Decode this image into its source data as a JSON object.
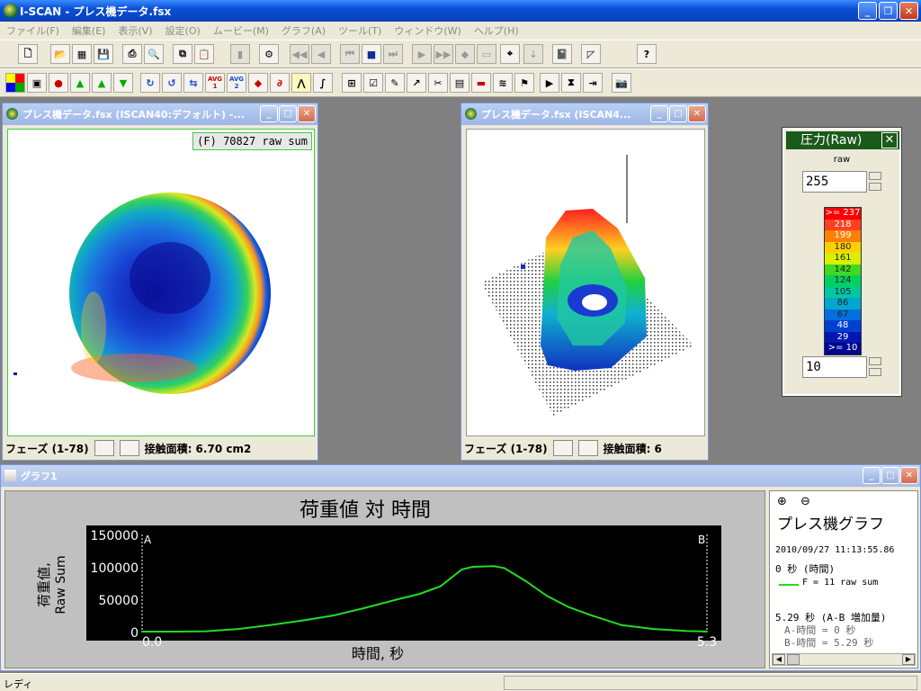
{
  "app": {
    "title": "I-SCAN - プレス機データ.fsx"
  },
  "menu": [
    "ファイル(F)",
    "編集(E)",
    "表示(V)",
    "設定(O)",
    "ムービー(M)",
    "グラフ(A)",
    "ツール(T)",
    "ウィンドウ(W)",
    "ヘルプ(H)"
  ],
  "toolbar2_labels": {
    "avg1": "AVG 1",
    "avg2": "AVG 2"
  },
  "win2d": {
    "title": "プレス機データ.fsx (ISCAN40:デフォルト) -...",
    "overlay": "(F) 70827 raw sum",
    "frame": "フェーズ (1-78)",
    "contact": "接触面積: 6.70 cm2"
  },
  "win3d": {
    "title": "プレス機データ.fsx (ISCAN4...",
    "frame": "フェーズ (1-78)",
    "contact": "接触面積: 6"
  },
  "legend": {
    "title": "圧力(Raw)",
    "unit": "raw",
    "max_value": "255",
    "min_value": "10",
    "scale": [
      {
        "label": ">= 237",
        "color": "#ff0000"
      },
      {
        "label": "218",
        "color": "#ff4020"
      },
      {
        "label": "199",
        "color": "#ff8000"
      },
      {
        "label": "180",
        "color": "#ffd000"
      },
      {
        "label": "161",
        "color": "#d8f000"
      },
      {
        "label": "142",
        "color": "#40d820"
      },
      {
        "label": "124",
        "color": "#00d060"
      },
      {
        "label": "105",
        "color": "#00c8a0"
      },
      {
        "label": "86",
        "color": "#00a8d0"
      },
      {
        "label": "67",
        "color": "#0070e0"
      },
      {
        "label": "48",
        "color": "#0040d0"
      },
      {
        "label": "29",
        "color": "#0018b0"
      },
      {
        "label": ">= 10",
        "color": "#000890"
      }
    ]
  },
  "graph": {
    "title_bar": "グラフ1",
    "chart_title": "荷重値 対 時間",
    "ylabel1": "荷重値,",
    "ylabel2": "Raw Sum",
    "xlabel": "時間, 秒",
    "marker_a": "A",
    "marker_b": "B",
    "panel_title": "プレス機グラフ",
    "datetime": "2010/09/27 11:13:55.86",
    "time_line": "0 秒 (時間)",
    "series_label": "F = 11 raw sum",
    "ab_line": "5.29 秒 (A-B 増加量)",
    "a_time": "A-時間 = 0 秒",
    "b_time": "B-時間 = 5.29 秒",
    "colors": {
      "line": "#22dd22",
      "bg": "#000000"
    }
  },
  "chart_data": {
    "type": "line",
    "x": [
      0,
      0.3,
      0.6,
      0.9,
      1.2,
      1.5,
      1.8,
      2.1,
      2.4,
      2.6,
      2.8,
      3.0,
      3.1,
      3.3,
      3.4,
      3.6,
      3.8,
      4.0,
      4.2,
      4.5,
      4.8,
      5.1,
      5.3
    ],
    "series": [
      {
        "values": [
          0,
          0,
          500,
          4000,
          10000,
          17000,
          25000,
          37000,
          50000,
          58000,
          70000,
          96000,
          100000,
          101000,
          98000,
          78000,
          55000,
          38000,
          26000,
          10000,
          4000,
          1000,
          200
        ]
      }
    ],
    "title": "荷重値 対 時間",
    "xlabel": "時間, 秒",
    "ylabel": "荷重値, Raw Sum",
    "ylim": [
      0,
      150000
    ],
    "xlim": [
      0.0,
      5.3
    ],
    "yticks": [
      "0",
      "50000",
      "100000",
      "150000"
    ],
    "xticks": [
      "0.0",
      "5.3"
    ],
    "grid": false
  },
  "statusbar": {
    "text": "レディ"
  }
}
